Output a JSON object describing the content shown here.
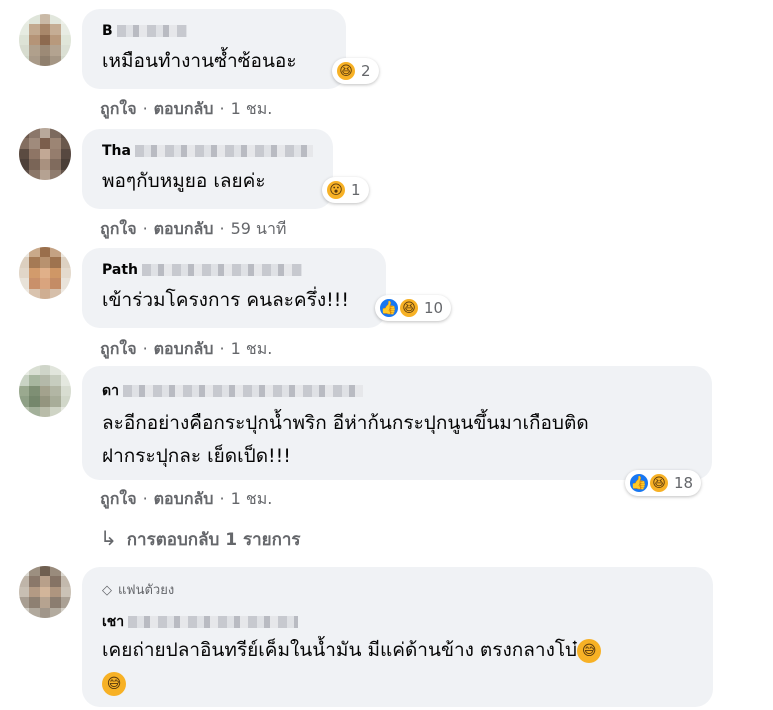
{
  "comments": [
    {
      "author": "B",
      "text": "เหมือนทำงานซ้ำซ้อนอะ",
      "reaction_count": "2",
      "reaction_icons": [
        "haha-icon"
      ],
      "like_label": "ถูกใจ",
      "reply_label": "ตอบกลับ",
      "time": "1 ชม."
    },
    {
      "author": "Tha",
      "text": "พอๆกับหมูยอ เลยค่ะ",
      "reaction_count": "1",
      "reaction_icons": [
        "wow-icon"
      ],
      "like_label": "ถูกใจ",
      "reply_label": "ตอบกลับ",
      "time": "59 นาที"
    },
    {
      "author": "Path",
      "text": "เข้าร่วมโครงการ คนละครึ่ง!!!",
      "reaction_count": "10",
      "reaction_icons": [
        "like-icon",
        "haha-icon"
      ],
      "like_label": "ถูกใจ",
      "reply_label": "ตอบกลับ",
      "time": "1 ชม."
    },
    {
      "author": "ดา",
      "text_line1": "ละอีกอย่างคือกระปุกน้ำพริก อีห่าก้นกระปุกนูนขึ้นมาเกือบติด",
      "text_line2": "ฝากระปุกละ เย็ดเป็ด!!!",
      "reaction_count": "18",
      "reaction_icons": [
        "like-icon",
        "haha-icon"
      ],
      "like_label": "ถูกใจ",
      "reply_label": "ตอบกลับ",
      "time": "1 ชม.",
      "replies_label": "การตอบกลับ 1 รายการ"
    },
    {
      "badge": "แฟนตัวยง",
      "author": "เชา",
      "text_line1": "เคยถ่ายปลาอินทรีย์เค็มในน้ำมัน มีแค่ด้านข้าง ตรงกลางโบ๋",
      "emoji": "grinning-sweat-icon"
    }
  ],
  "colors": {
    "bubble": "#f0f2f5",
    "secondary_text": "#65676b",
    "like_blue": "#1877f2",
    "emoji_yellow": "#f7b125"
  }
}
